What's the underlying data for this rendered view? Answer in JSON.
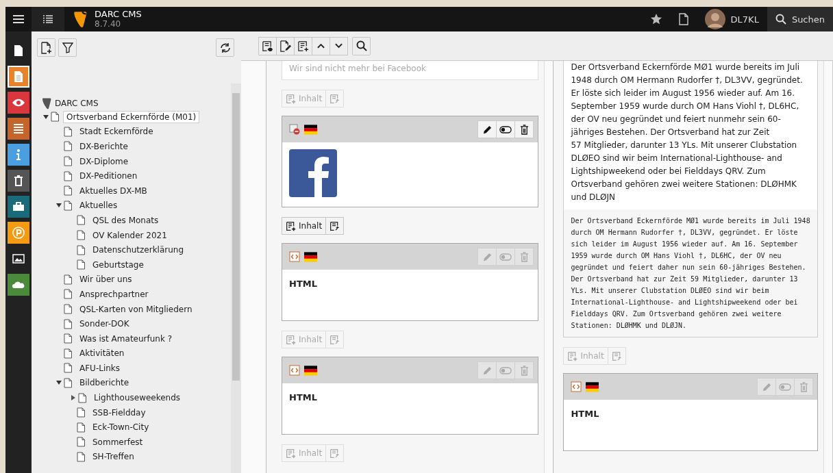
{
  "topbar": {
    "site_name": "DARC CMS",
    "version": "8.7.40",
    "username": "DL7KL",
    "search_label": "Suchen"
  },
  "modules": [
    {
      "color": "#222222",
      "selected": false
    },
    {
      "color": "#e8822b",
      "selected": true
    },
    {
      "color": "#d9363e",
      "selected": false
    },
    {
      "color": "#c5642b",
      "selected": false
    },
    {
      "color": "#4b9fe0",
      "selected": false
    },
    {
      "color": "#555555",
      "selected": false
    },
    {
      "color": "#1a6b7a",
      "selected": false
    },
    {
      "color": "#f39c12",
      "selected": false
    },
    {
      "color": "#222222",
      "selected": false
    },
    {
      "color": "#4a8a3a",
      "selected": false
    }
  ],
  "tree": {
    "root": "DARC CMS",
    "items": [
      {
        "label": "Ortsverband Eckernförde (M01)",
        "selected": true,
        "expanded": true,
        "children": [
          {
            "label": "Stadt Eckernförde",
            "selected": false
          },
          {
            "label": "DX-Berichte",
            "selected": false
          },
          {
            "label": "DX-Diplome",
            "selected": false
          },
          {
            "label": "DX-Peditionen",
            "selected": false
          },
          {
            "label": "Aktuelles DX-MB",
            "selected": false
          },
          {
            "label": "Aktuelles",
            "selected": false,
            "expanded": true,
            "children": [
              {
                "label": "QSL des Monats",
                "selected": false
              },
              {
                "label": "OV Kalender 2021",
                "selected": false
              },
              {
                "label": "Datenschutzerklärung",
                "selected": false
              },
              {
                "label": "Geburtstage",
                "selected": false
              }
            ]
          },
          {
            "label": "Wir über uns",
            "selected": false
          },
          {
            "label": "Ansprechpartner",
            "selected": false
          },
          {
            "label": "QSL-Karten von Mitgliedern",
            "selected": false
          },
          {
            "label": "Sonder-DOK",
            "selected": false
          },
          {
            "label": "Was ist Amateurfunk ?",
            "selected": false
          },
          {
            "label": "Aktivitäten",
            "selected": false
          },
          {
            "label": "AFU-Links",
            "selected": false
          },
          {
            "label": "Bildberichte",
            "selected": false,
            "expanded": true,
            "children": [
              {
                "label": "Lighthouseweekends",
                "selected": false,
                "expanded": false,
                "has_children": true
              },
              {
                "label": "SSB-Fieldday",
                "selected": false
              },
              {
                "label": "Eck-Town-City",
                "selected": false
              },
              {
                "label": "Sommerfest",
                "selected": false
              },
              {
                "label": "SH-Treffen",
                "selected": false
              }
            ]
          }
        ]
      }
    ]
  },
  "columns": [
    {
      "items": [
        {
          "kind": "text",
          "muted": true,
          "text": "Wir sind nicht mehr bei Facebook"
        },
        {
          "kind": "add",
          "label": "Inhalt",
          "disabled": true
        },
        {
          "kind": "image",
          "hidden": true,
          "actions_disabled": false
        },
        {
          "kind": "add",
          "label": "Inhalt",
          "disabled": false
        },
        {
          "kind": "html",
          "hidden": false,
          "actions_disabled": true,
          "title": "HTML"
        },
        {
          "kind": "add",
          "label": "Inhalt",
          "disabled": true
        },
        {
          "kind": "html",
          "hidden": false,
          "actions_disabled": true,
          "title": "HTML"
        },
        {
          "kind": "add",
          "label": "Inhalt",
          "disabled": true
        }
      ]
    },
    {
      "items": [
        {
          "kind": "richtext",
          "text": "Der Ortsverband Eckernförde MØ1 wurde bereits im Juli 1948 durch OM Hermann Rudorfer †, DL3VV, gegründet. Er löste sich leider im August 1956 wieder auf. Am 16. September 1959 wurde durch OM Hans Viohl †, DL6HC, der OV neu gegründet und feiert nunmehr sein 60-jähriges Bestehen. Der Ortsverband hat zur Zeit\n57 Mitglieder, darunter 13 YLs. Mit unserer Clubstation DLØEO sind wir beim International-Lighthouse- and Lightshipweekend oder bei Fielddays QRV. Zum Ortsverband gehören zwei weitere Stationen: DLØHMK und DLØJN",
          "code": "Der Ortsverband Eckernförde MØ1 wurde bereits im Juli 1948 durch OM Hermann Rudorfer †, DL3VV, gegründet. Er löste sich leider im August 1956 wieder auf. Am 16. September 1959 wurde durch OM Hans Viohl †, DL6HC, der OV neu gegründet und feiert daher nun sein 60-jähriges Bestehen. Der Ortsverband hat zur Zeit 59 Mitglieder, darunter 13 YLs. Mit unserer Clubstation DLØEO sind wir beim International-Lighthouse- and Lightshipweekend oder bei Fielddays QRV. Zum Ortsverband gehören zwei weitere Stationen: DLØHMK und DLØJN."
        },
        {
          "kind": "add",
          "label": "Inhalt",
          "disabled": true
        },
        {
          "kind": "html",
          "hidden": false,
          "actions_disabled": true,
          "title": "HTML"
        }
      ]
    }
  ]
}
